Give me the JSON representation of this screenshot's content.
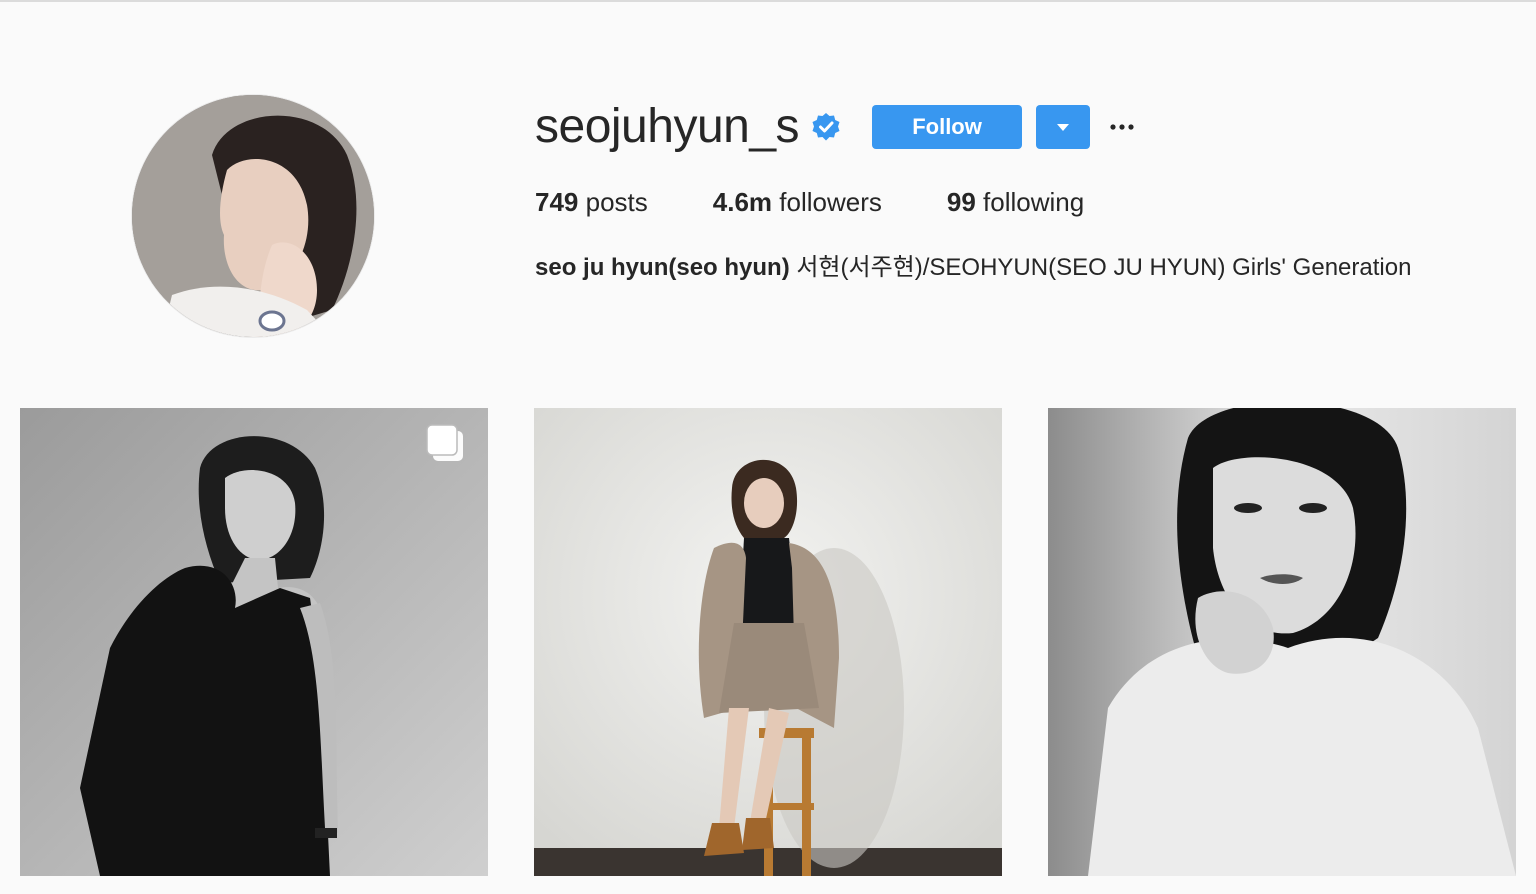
{
  "profile": {
    "username": "seojuhyun_s",
    "verified": true,
    "avatar_icon": "profile-photo",
    "follow_label": "Follow",
    "dropdown_icon": "caret-down-icon",
    "more_icon": "ellipsis-icon",
    "accent_color": "#3897f0"
  },
  "stats": {
    "posts_count": "749",
    "posts_label": "posts",
    "followers_count": "4.6m",
    "followers_label": "followers",
    "following_count": "99",
    "following_label": "following"
  },
  "bio": {
    "full_name": "seo ju hyun(seo hyun)",
    "text": " 서현(서주현)/SEOHYUN(SEO JU HYUN) Girls' Generation"
  },
  "posts": [
    {
      "type": "carousel",
      "tone": "monochrome",
      "badge_icon": "multiple-posts-icon"
    },
    {
      "type": "photo",
      "tone": "color"
    },
    {
      "type": "photo",
      "tone": "monochrome"
    }
  ]
}
